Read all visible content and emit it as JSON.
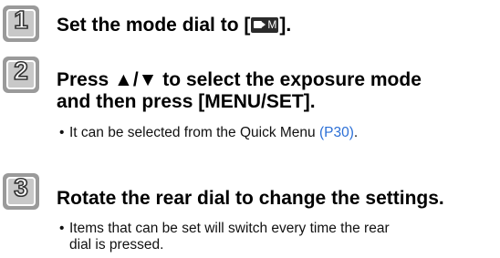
{
  "steps": [
    {
      "number": "1",
      "text_before": "Set the mode dial to [",
      "icon_label": "M",
      "text_after": "]."
    },
    {
      "number": "2",
      "line1": "Press ▲/▼ to select the exposure mode",
      "line2": "and then press [MENU/SET].",
      "bullet_text": "It can be selected from the Quick Menu ",
      "bullet_link": "(P30)",
      "bullet_end": "."
    },
    {
      "number": "3",
      "text": "Rotate the rear dial to change the settings.",
      "bullet_line1": "Items that can be set will switch every time the rear",
      "bullet_line2": "dial is pressed."
    }
  ],
  "colors": {
    "badge_fill": "#c8c8c8",
    "badge_border": "#9a9a9a",
    "link": "#2b6fd6"
  },
  "icons": {
    "step_badge": "step-number-badge",
    "mode_dial": "movie-camera-mode-icon"
  }
}
